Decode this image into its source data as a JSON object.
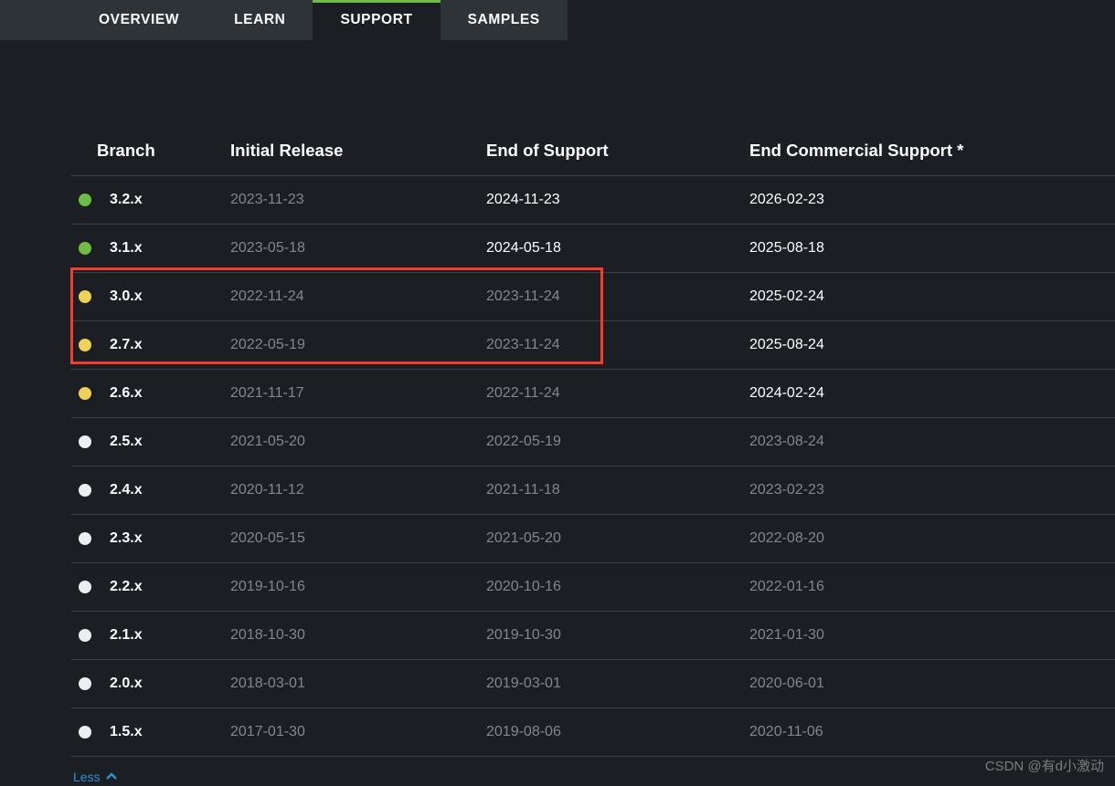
{
  "tabs": {
    "overview": "OVERVIEW",
    "learn": "LEARN",
    "support": "SUPPORT",
    "samples": "SAMPLES",
    "active": "support"
  },
  "table": {
    "headers": {
      "branch": "Branch",
      "initial": "Initial Release",
      "eos": "End of Support",
      "ecs": "End Commercial Support *"
    },
    "rows": [
      {
        "status": "green",
        "branch": "3.2.x",
        "initial": "2023-11-23",
        "eos": "2024-11-23",
        "ecs": "2026-02-23",
        "initial_muted": true,
        "eos_muted": false,
        "ecs_muted": false
      },
      {
        "status": "green",
        "branch": "3.1.x",
        "initial": "2023-05-18",
        "eos": "2024-05-18",
        "ecs": "2025-08-18",
        "initial_muted": true,
        "eos_muted": false,
        "ecs_muted": false
      },
      {
        "status": "yellow",
        "branch": "3.0.x",
        "initial": "2022-11-24",
        "eos": "2023-11-24",
        "ecs": "2025-02-24",
        "initial_muted": true,
        "eos_muted": true,
        "ecs_muted": false
      },
      {
        "status": "yellow",
        "branch": "2.7.x",
        "initial": "2022-05-19",
        "eos": "2023-11-24",
        "ecs": "2025-08-24",
        "initial_muted": true,
        "eos_muted": true,
        "ecs_muted": false
      },
      {
        "status": "yellow",
        "branch": "2.6.x",
        "initial": "2021-11-17",
        "eos": "2022-11-24",
        "ecs": "2024-02-24",
        "initial_muted": true,
        "eos_muted": true,
        "ecs_muted": false
      },
      {
        "status": "grey",
        "branch": "2.5.x",
        "initial": "2021-05-20",
        "eos": "2022-05-19",
        "ecs": "2023-08-24",
        "initial_muted": true,
        "eos_muted": true,
        "ecs_muted": true
      },
      {
        "status": "grey",
        "branch": "2.4.x",
        "initial": "2020-11-12",
        "eos": "2021-11-18",
        "ecs": "2023-02-23",
        "initial_muted": true,
        "eos_muted": true,
        "ecs_muted": true
      },
      {
        "status": "grey",
        "branch": "2.3.x",
        "initial": "2020-05-15",
        "eos": "2021-05-20",
        "ecs": "2022-08-20",
        "initial_muted": true,
        "eos_muted": true,
        "ecs_muted": true
      },
      {
        "status": "grey",
        "branch": "2.2.x",
        "initial": "2019-10-16",
        "eos": "2020-10-16",
        "ecs": "2022-01-16",
        "initial_muted": true,
        "eos_muted": true,
        "ecs_muted": true
      },
      {
        "status": "grey",
        "branch": "2.1.x",
        "initial": "2018-10-30",
        "eos": "2019-10-30",
        "ecs": "2021-01-30",
        "initial_muted": true,
        "eos_muted": true,
        "ecs_muted": true
      },
      {
        "status": "grey",
        "branch": "2.0.x",
        "initial": "2018-03-01",
        "eos": "2019-03-01",
        "ecs": "2020-06-01",
        "initial_muted": true,
        "eos_muted": true,
        "ecs_muted": true
      },
      {
        "status": "grey",
        "branch": "1.5.x",
        "initial": "2017-01-30",
        "eos": "2019-08-06",
        "ecs": "2020-11-06",
        "initial_muted": true,
        "eos_muted": true,
        "ecs_muted": true
      }
    ]
  },
  "less_label": "Less",
  "watermark": "CSDN @有d小激动"
}
